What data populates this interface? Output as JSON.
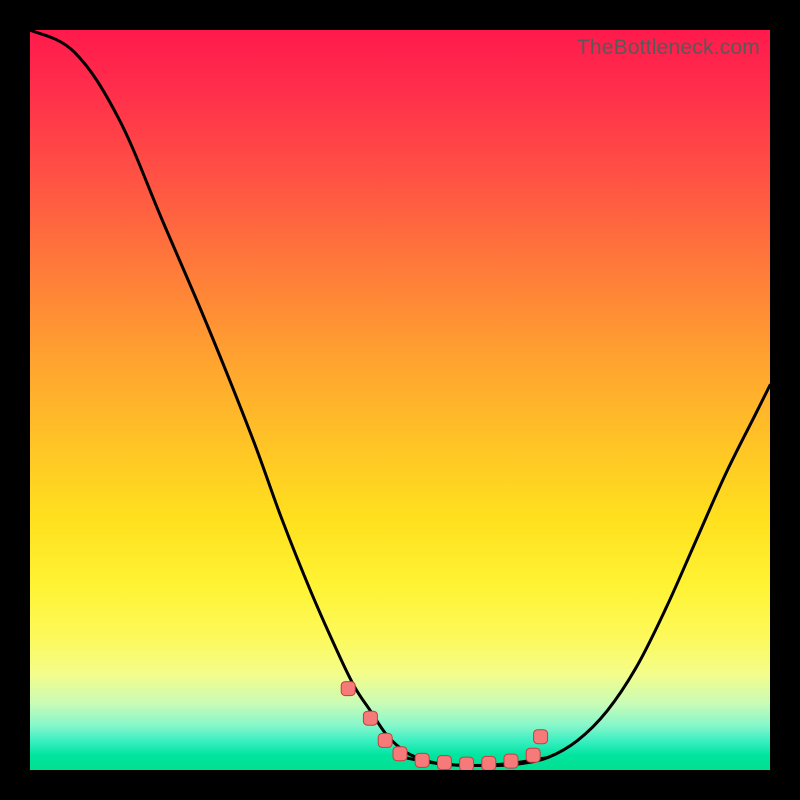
{
  "watermark": "TheBottleneck.com",
  "chart_data": {
    "type": "line",
    "title": "",
    "xlabel": "",
    "ylabel": "",
    "xlim": [
      0,
      100
    ],
    "ylim": [
      0,
      100
    ],
    "series": [
      {
        "name": "left-curve",
        "x": [
          0,
          6,
          12,
          18,
          24,
          30,
          34,
          38,
          42,
          44,
          46,
          48,
          50,
          52,
          55,
          59
        ],
        "values": [
          100,
          97,
          88,
          74,
          60,
          45,
          34,
          24,
          15,
          11,
          8,
          5,
          3,
          1.8,
          0.9,
          0.6
        ]
      },
      {
        "name": "flat-minimum",
        "x": [
          50,
          55,
          60,
          65,
          70
        ],
        "values": [
          1.8,
          0.9,
          0.6,
          0.9,
          1.7
        ]
      },
      {
        "name": "right-curve",
        "x": [
          63,
          66,
          70,
          74,
          78,
          82,
          86,
          90,
          94,
          98,
          100
        ],
        "values": [
          0.6,
          0.8,
          1.7,
          4,
          8,
          14,
          22,
          31,
          40,
          48,
          52
        ]
      }
    ],
    "markers": {
      "name": "pink-markers",
      "x": [
        43,
        46,
        48,
        50,
        53,
        56,
        59,
        62,
        65,
        68,
        69
      ],
      "values": [
        11,
        7,
        4,
        2.2,
        1.3,
        1.0,
        0.8,
        0.9,
        1.2,
        2.0,
        4.5
      ]
    },
    "colors": {
      "curve": "#000000",
      "marker_fill": "#f77a7a",
      "marker_stroke": "#c43e3e",
      "gradient_top": "#ff1a4c",
      "gradient_mid": "#ffe01e",
      "gradient_bottom": "#02df90"
    }
  }
}
